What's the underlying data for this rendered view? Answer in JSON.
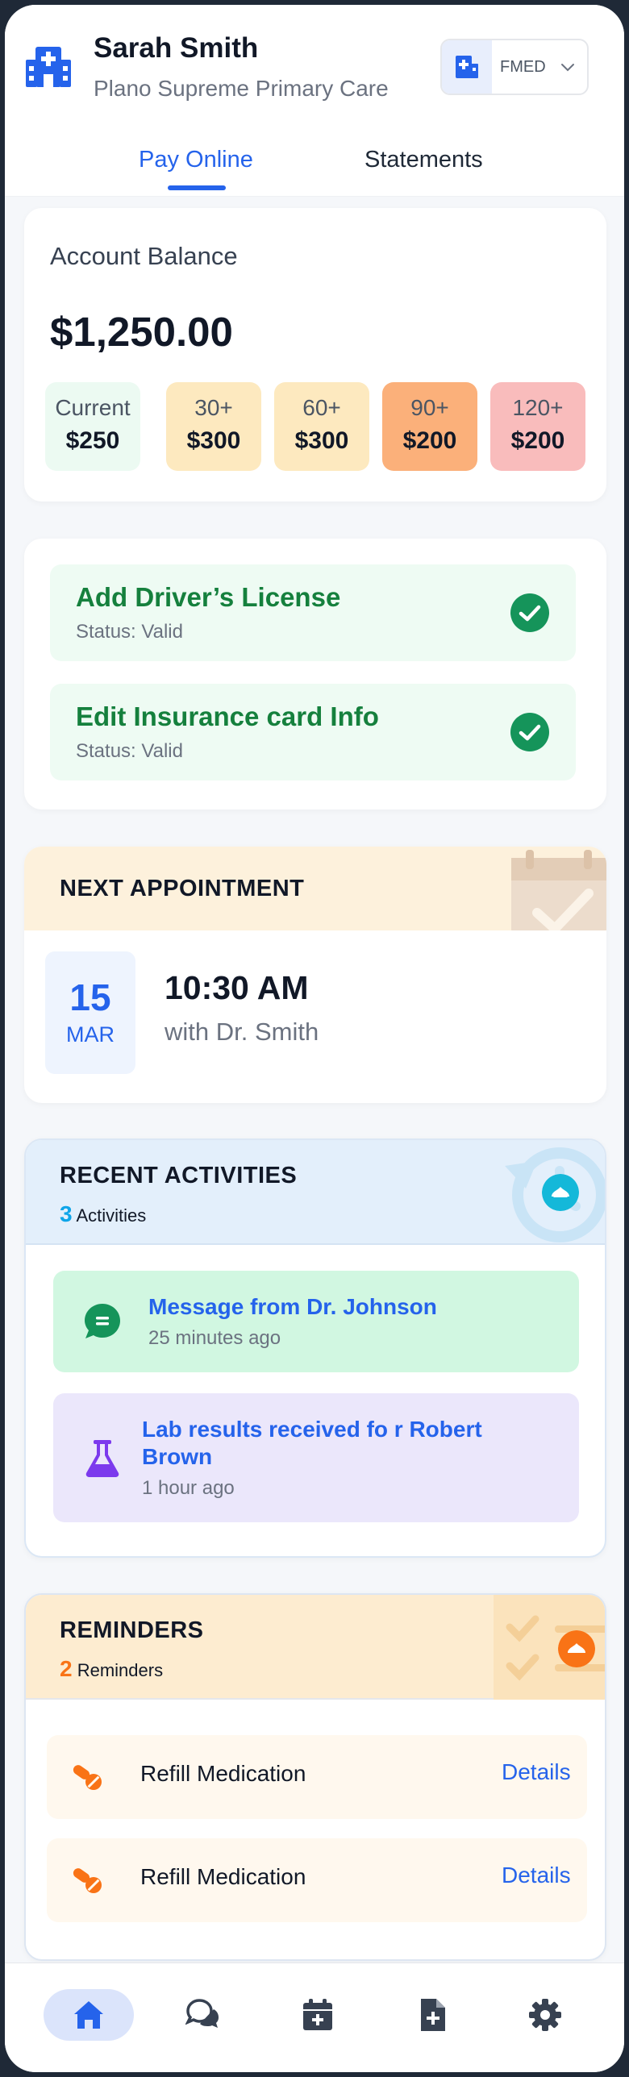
{
  "header": {
    "user_name": "Sarah Smith",
    "clinic_name": "Plano Supreme Primary Care",
    "org_code": "FMED",
    "logo_icon": "hospital-building-icon"
  },
  "tabs": [
    {
      "label": "Pay Online",
      "active": true
    },
    {
      "label": "Statements",
      "active": false
    }
  ],
  "balance": {
    "label": "Account Balance",
    "amount": "$1,250.00",
    "aging": [
      {
        "label": "Current",
        "value": "$250",
        "color": "#ecfaf2"
      },
      {
        "label": "30+",
        "value": "$300",
        "color": "#fde9bf"
      },
      {
        "label": "60+",
        "value": "$300",
        "color": "#fde9bf"
      },
      {
        "label": "90+",
        "value": "$200",
        "color": "#fbb07a"
      },
      {
        "label": "120+",
        "value": "$200",
        "color": "#f9bcbc"
      }
    ]
  },
  "documents": [
    {
      "title": "Add Driver’s License",
      "status": "Status: Valid",
      "icon": "check-circle-icon"
    },
    {
      "title": "Edit Insurance card Info",
      "status": "Status: Valid",
      "icon": "check-circle-icon"
    }
  ],
  "appointment": {
    "title": "NEXT APPOINTMENT",
    "day": "15",
    "month": "MAR",
    "time": "10:30 AM",
    "with": "with Dr. Smith"
  },
  "activities": {
    "title": "RECENT ACTIVITIES",
    "count": "3",
    "count_label": "Activities",
    "items": [
      {
        "title": "Message from Dr. Johnson",
        "time": "25 minutes ago",
        "icon": "message-icon",
        "bg": "#d1f7e1"
      },
      {
        "title": "Lab results received fo r Robert Brown",
        "time": "1 hour ago",
        "icon": "flask-icon",
        "bg": "#ebe7fb"
      }
    ]
  },
  "reminders": {
    "title": "REMINDERS",
    "count": "2",
    "count_label": "Reminders",
    "items": [
      {
        "text": "Refill Medication",
        "link": "Details",
        "icon": "pill-icon"
      },
      {
        "text": "Refill Medication",
        "link": "Details",
        "icon": "pill-icon"
      }
    ]
  },
  "nav": [
    {
      "name": "home",
      "icon": "home-icon",
      "active": true
    },
    {
      "name": "messages",
      "icon": "chat-icon",
      "active": false
    },
    {
      "name": "appointments",
      "icon": "calendar-plus-icon",
      "active": false
    },
    {
      "name": "documents",
      "icon": "file-plus-icon",
      "active": false
    },
    {
      "name": "settings",
      "icon": "gear-icon",
      "active": false
    }
  ],
  "colors": {
    "primary": "#2563eb",
    "success": "#15803d",
    "activity_accent": "#0ea5e9",
    "reminder_accent": "#f97316"
  }
}
